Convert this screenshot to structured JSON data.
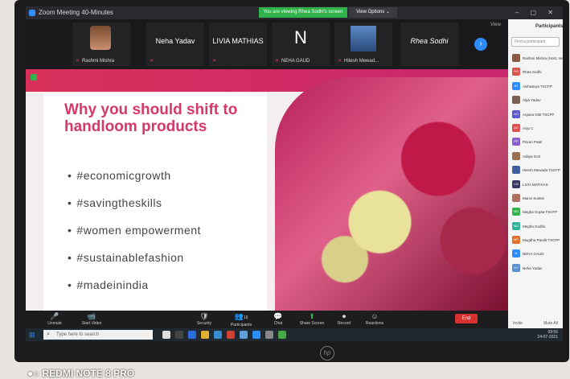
{
  "window": {
    "title": "Zoom Meeting 40-Minutes"
  },
  "banner": {
    "viewing": "You are viewing Rhea Sodhi's screen",
    "view_options": "View Options ⌄"
  },
  "window_buttons": "– ▢ ✕",
  "strip": {
    "view_label": "View",
    "tiles": [
      {
        "name": "",
        "sub": "Rashmi Mishra"
      },
      {
        "name": "Neha Yadav",
        "sub": ""
      },
      {
        "name": "LIVIA MATHIAS",
        "sub": ""
      },
      {
        "name": "N",
        "sub": "NEHA GAUD"
      },
      {
        "name": "",
        "sub": "Hitesh Mewad..."
      },
      {
        "name": "Rhea Sodhi",
        "sub": ""
      }
    ]
  },
  "slide": {
    "heading": "Why you should shift to handloom products",
    "bullets": [
      "#economicgrowth",
      "#savingtheskills",
      "#women empowerment",
      "#sustainablefashion",
      "#madeinindia"
    ]
  },
  "toolbar": {
    "buttons": [
      {
        "icon": "🎤",
        "label": "Unmute"
      },
      {
        "icon": "📹",
        "label": "Start Video"
      },
      {
        "icon": "🛡",
        "label": "Security"
      },
      {
        "icon": "👥",
        "label": "Participants"
      },
      {
        "icon": "💬",
        "label": "Chat"
      },
      {
        "icon": "⬆",
        "label": "Share Screen"
      },
      {
        "icon": "⏺",
        "label": "Record"
      },
      {
        "icon": "☺",
        "label": "Reactions"
      }
    ],
    "participants_count": "19",
    "end_label": "End"
  },
  "panel": {
    "title": "Participants",
    "find_placeholder": "Find a participant",
    "participants": [
      {
        "initials": "",
        "name": "Rashmi Mishra (Host, me)",
        "color": "#8a5a40"
      },
      {
        "initials": "RS",
        "name": "Rhea Sodhi",
        "color": "#d9534f"
      },
      {
        "initials": "AT",
        "name": "Aishwarya TSCFP",
        "color": "#2d8cff"
      },
      {
        "initials": "",
        "name": "Alpa Yadav",
        "color": "#7a6050"
      },
      {
        "initials": "AO",
        "name": "Anjana Gite TSCFP",
        "color": "#5a5ad0"
      },
      {
        "initials": "AC",
        "name": "Anju C",
        "color": "#e05050"
      },
      {
        "initials": "PP",
        "name": "Pavan Patel",
        "color": "#8a60d0"
      },
      {
        "initials": "",
        "name": "Aditya Gori",
        "color": "#9a7050"
      },
      {
        "initials": "",
        "name": "Hitesh Mewada TSCFP",
        "color": "#4060a0"
      },
      {
        "initials": "LM",
        "name": "LIVIA MATHIAS",
        "color": "#3a3a6a"
      },
      {
        "initials": "",
        "name": "Manvi Sunkie",
        "color": "#b07060"
      },
      {
        "initials": "MG",
        "name": "Megha Gupta TSCFP",
        "color": "#2fb34a"
      },
      {
        "initials": "MG",
        "name": "Megha Godhs",
        "color": "#2fb39a"
      },
      {
        "initials": "MP",
        "name": "Mugdha Pandit TSCFP",
        "color": "#e07030"
      },
      {
        "initials": "N",
        "name": "NEHA GAUD",
        "color": "#2d8cff"
      },
      {
        "initials": "NY",
        "name": "Neha Yadav",
        "color": "#5a90d0"
      }
    ],
    "footer": [
      "Invite",
      "Mute All"
    ]
  },
  "taskbar": {
    "search_placeholder": "Type here to search",
    "time": "09:56",
    "date": "24-07-2021"
  },
  "hp_logo": "hp",
  "watermark": "REDMI NOTE 8 PRO"
}
